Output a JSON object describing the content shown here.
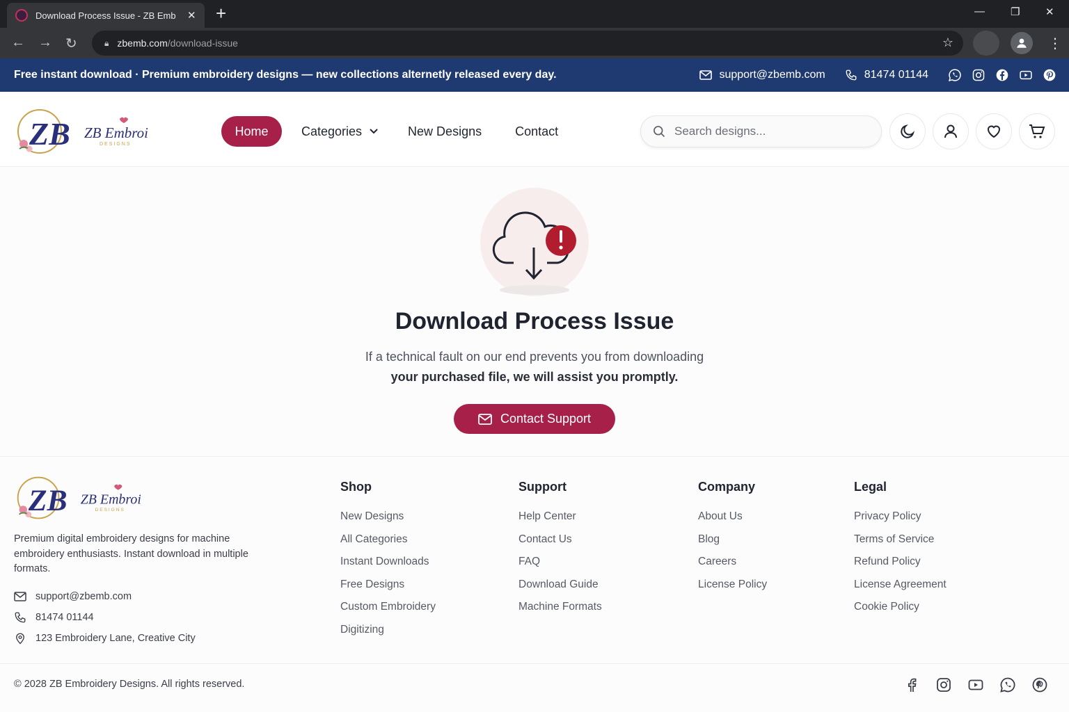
{
  "browser": {
    "tab_title": "Download Process Issue - ZB Emb",
    "url_domain": "zbemb.com",
    "url_path": "/download-issue"
  },
  "announcement": {
    "text": "Free instant download · Premium embroidery designs — new collections alternetly released every day.",
    "email": "support@zbemb.com",
    "phone": "81474 01144",
    "social_icons": [
      "whatsapp-icon",
      "instagram-icon",
      "facebook-icon",
      "youtube-icon",
      "pinterest-icon"
    ]
  },
  "header": {
    "logo_text": "ZB Embroidery",
    "logo_sub": "DESIGNS",
    "nav": {
      "home": "Home",
      "categories": "Categories",
      "new_designs": "New Designs",
      "contact": "Contact"
    },
    "search_placeholder": "Search designs...",
    "icons": [
      "moon-icon",
      "user-icon",
      "heart-icon",
      "cart-icon"
    ]
  },
  "main": {
    "title": "Download Process Issue",
    "desc_line1": "If a technical fault on our end prevents you from downloading",
    "desc_line2": "your purchased file, we will assist you promptly.",
    "cta": "Contact Support"
  },
  "footer": {
    "about": "Premium digital embroidery designs for machine embroidery enthusiasts. Instant download in multiple formats.",
    "email": "support@zbemb.com",
    "phone": "81474 01144",
    "address": "123 Embroidery Lane, Creative City",
    "columns": [
      {
        "title": "Shop",
        "links": [
          "New Designs",
          "All Categories",
          "Instant Downloads",
          "Free Designs",
          "Custom Embroidery",
          "Digitizing"
        ]
      },
      {
        "title": "Support",
        "links": [
          "Help Center",
          "Contact Us",
          "FAQ",
          "Download Guide",
          "Machine Formats"
        ]
      },
      {
        "title": "Company",
        "links": [
          "About Us",
          "Blog",
          "Careers",
          "License Policy"
        ]
      },
      {
        "title": "Legal",
        "links": [
          "Privacy Policy",
          "Terms of Service",
          "Refund Policy",
          "License Agreement",
          "Cookie Policy"
        ]
      }
    ],
    "copyright": "© 2028 ZB Embroidery Designs. All rights reserved."
  },
  "colors": {
    "brand": "#a6204a",
    "announce_bg": "#1f3a70",
    "text": "#1f2430"
  }
}
